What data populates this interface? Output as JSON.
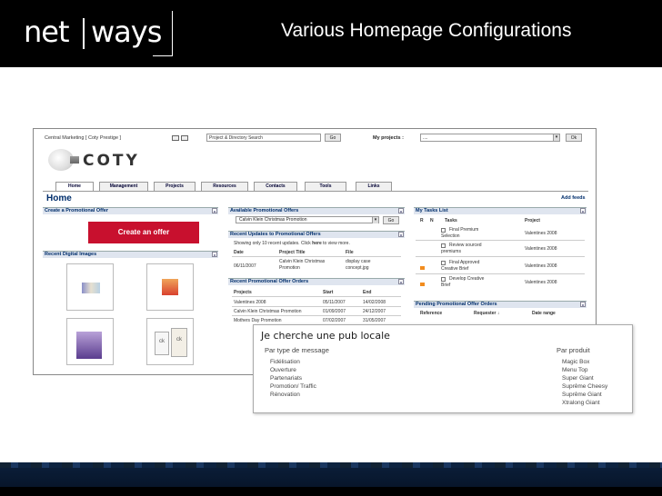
{
  "slide": {
    "logo_left": "net",
    "logo_right": "ways",
    "title": "Various Homepage Configurations"
  },
  "screenshot": {
    "top_line": "Central Marketing   [ Coty Prestige ]",
    "search_value": "Project & Directory Search",
    "go_label": "Go",
    "ok_label": "Ok",
    "my_projects_label": "My projects :",
    "projects_select_value": "....",
    "brand": "COTY",
    "tabs": [
      "Home",
      "Management",
      "Projects",
      "Resources",
      "Contacts",
      "Tools",
      "Links"
    ],
    "page_heading": "Home",
    "add_feeds": "Add feeds",
    "close_glyph": "x",
    "create_offer": {
      "header": "Create a Promotional Offer",
      "button": "Create an offer"
    },
    "recent_images": {
      "header": "Recent Digital Images",
      "thumb_label": "ck"
    },
    "available_offers": {
      "header": "Available Promotional Offers",
      "select_value": "Calvin Klein Christmas Promotion",
      "go": "Go"
    },
    "recent_updates": {
      "header": "Recent Updates to Promotional Offers",
      "note_prefix": "Showing only 10 recent updates. Click ",
      "note_link": "here",
      "note_suffix": " to view more.",
      "columns": [
        "Date",
        "Project Title",
        "File"
      ],
      "rows": [
        {
          "date": "06/11/2007",
          "title_line1": "Calvin Klein Christmas",
          "title_line2": "Promotion",
          "file_line1": "display case",
          "file_line2": "concept.jpg"
        }
      ]
    },
    "recent_orders": {
      "header": "Recent Promotional Offer Orders",
      "columns": [
        "Projects",
        "Start",
        "End"
      ],
      "rows": [
        {
          "project": "Valentines 2008",
          "start": "05/11/2007",
          "end": "14/02/2008"
        },
        {
          "project": "Calvin Klein Christmas Promotion",
          "start": "01/09/2007",
          "end": "24/12/2007"
        },
        {
          "project": "Mothers Day Promotion",
          "start": "07/02/2007",
          "end": "31/05/2007"
        }
      ]
    },
    "tasks": {
      "header": "My Tasks List",
      "columns": [
        "R",
        "N",
        "Tasks",
        "Project"
      ],
      "rows": [
        {
          "line1": "Final Premium",
          "line2": "Selection",
          "project": "Valentines 2008",
          "flag": false
        },
        {
          "line1": "Review sourced",
          "line2": "premiums",
          "project": "Valentines 2008",
          "flag": false
        },
        {
          "line1": "Final Approved",
          "line2": "Creative Brief",
          "project": "Valentines 2008",
          "flag": true
        },
        {
          "line1": "Develop Creative",
          "line2": "Brief",
          "project": "Valentines 2008",
          "flag": true
        }
      ]
    },
    "pending_orders": {
      "header": "Pending Promotional Offer Orders",
      "columns": [
        "Reference",
        "Requester ↓",
        "Date range"
      ]
    }
  },
  "overlay": {
    "title": "Je cherche une pub locale",
    "left_heading": "Par type de message",
    "left_items": [
      "Fidélisation",
      "Ouverture",
      "Partenariats",
      "Promotion/ Traffic",
      "Rénovation"
    ],
    "right_heading": "Par produit",
    "right_items": [
      "Magic Box",
      "Menu Top",
      "Super Giant",
      "Suprême Cheesy",
      "Suprême Giant",
      "Xtralong Giant"
    ]
  },
  "colors": {
    "header_bg": "#000000",
    "accent_red": "#c8102e",
    "panel_head": "#dfe5ef",
    "flag_orange": "#f28c1e",
    "footer_navy": "#0b1f3b"
  }
}
